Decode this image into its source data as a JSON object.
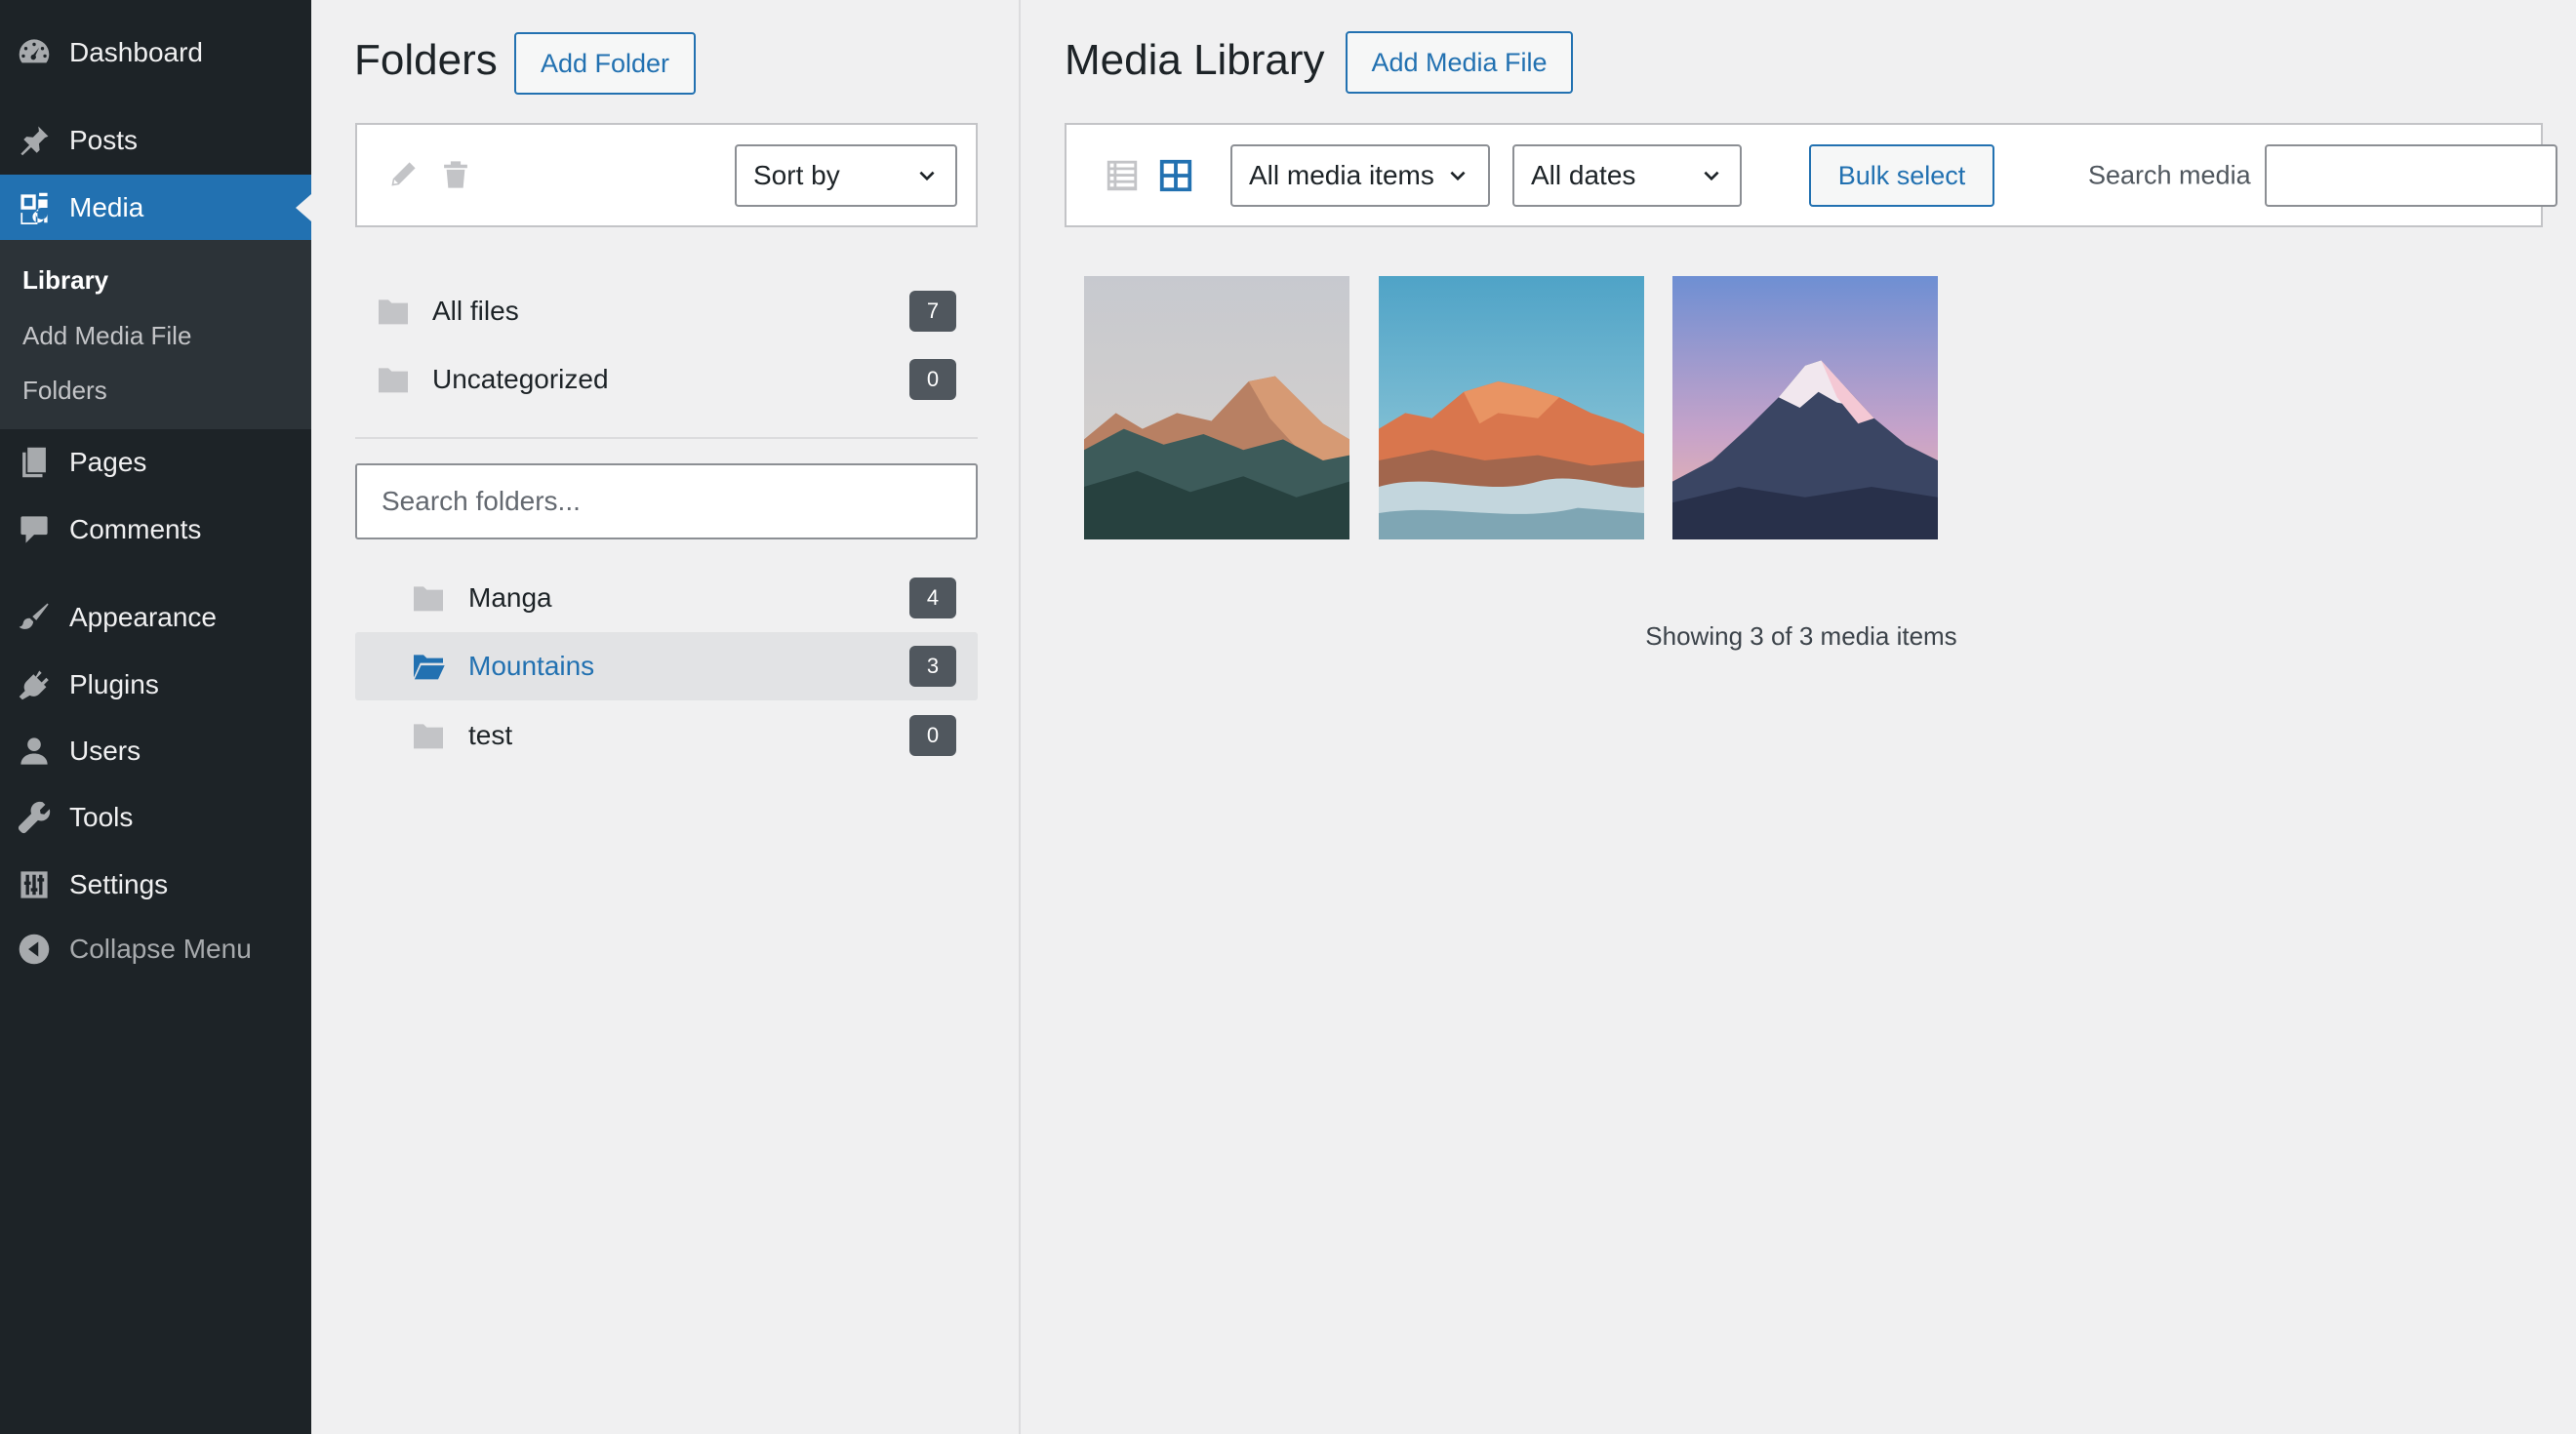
{
  "sidebar": {
    "items": [
      {
        "key": "dashboard",
        "label": "Dashboard",
        "icon": "dashboard-icon"
      },
      {
        "key": "posts",
        "label": "Posts",
        "icon": "pin-icon"
      },
      {
        "key": "media",
        "label": "Media",
        "icon": "media-icon",
        "active": true
      },
      {
        "key": "pages",
        "label": "Pages",
        "icon": "pages-icon"
      },
      {
        "key": "comments",
        "label": "Comments",
        "icon": "comment-icon"
      },
      {
        "key": "appearance",
        "label": "Appearance",
        "icon": "brush-icon"
      },
      {
        "key": "plugins",
        "label": "Plugins",
        "icon": "plug-icon"
      },
      {
        "key": "users",
        "label": "Users",
        "icon": "user-icon"
      },
      {
        "key": "tools",
        "label": "Tools",
        "icon": "wrench-icon"
      },
      {
        "key": "settings",
        "label": "Settings",
        "icon": "sliders-icon"
      },
      {
        "key": "collapse",
        "label": "Collapse Menu",
        "icon": "collapse-icon"
      }
    ],
    "submenu": [
      "Library",
      "Add Media File",
      "Folders"
    ]
  },
  "folders": {
    "title": "Folders",
    "add_button": "Add Folder",
    "sort_label": "Sort by",
    "system_folders": [
      {
        "name": "All files",
        "count": "7"
      },
      {
        "name": "Uncategorized",
        "count": "0"
      }
    ],
    "search_placeholder": "Search folders...",
    "user_folders": [
      {
        "name": "Manga",
        "count": "4",
        "selected": false
      },
      {
        "name": "Mountains",
        "count": "3",
        "selected": true
      },
      {
        "name": "test",
        "count": "0",
        "selected": false
      }
    ]
  },
  "media": {
    "title": "Media Library",
    "add_button": "Add Media File",
    "type_filter": "All media items",
    "date_filter": "All dates",
    "bulk_select": "Bulk select",
    "search_label": "Search media",
    "search_value": "",
    "status": "Showing 3 of 3 media items"
  },
  "colors": {
    "sidebar_bg": "#1d2327",
    "accent": "#2271b1",
    "badge_bg": "#50575e"
  }
}
